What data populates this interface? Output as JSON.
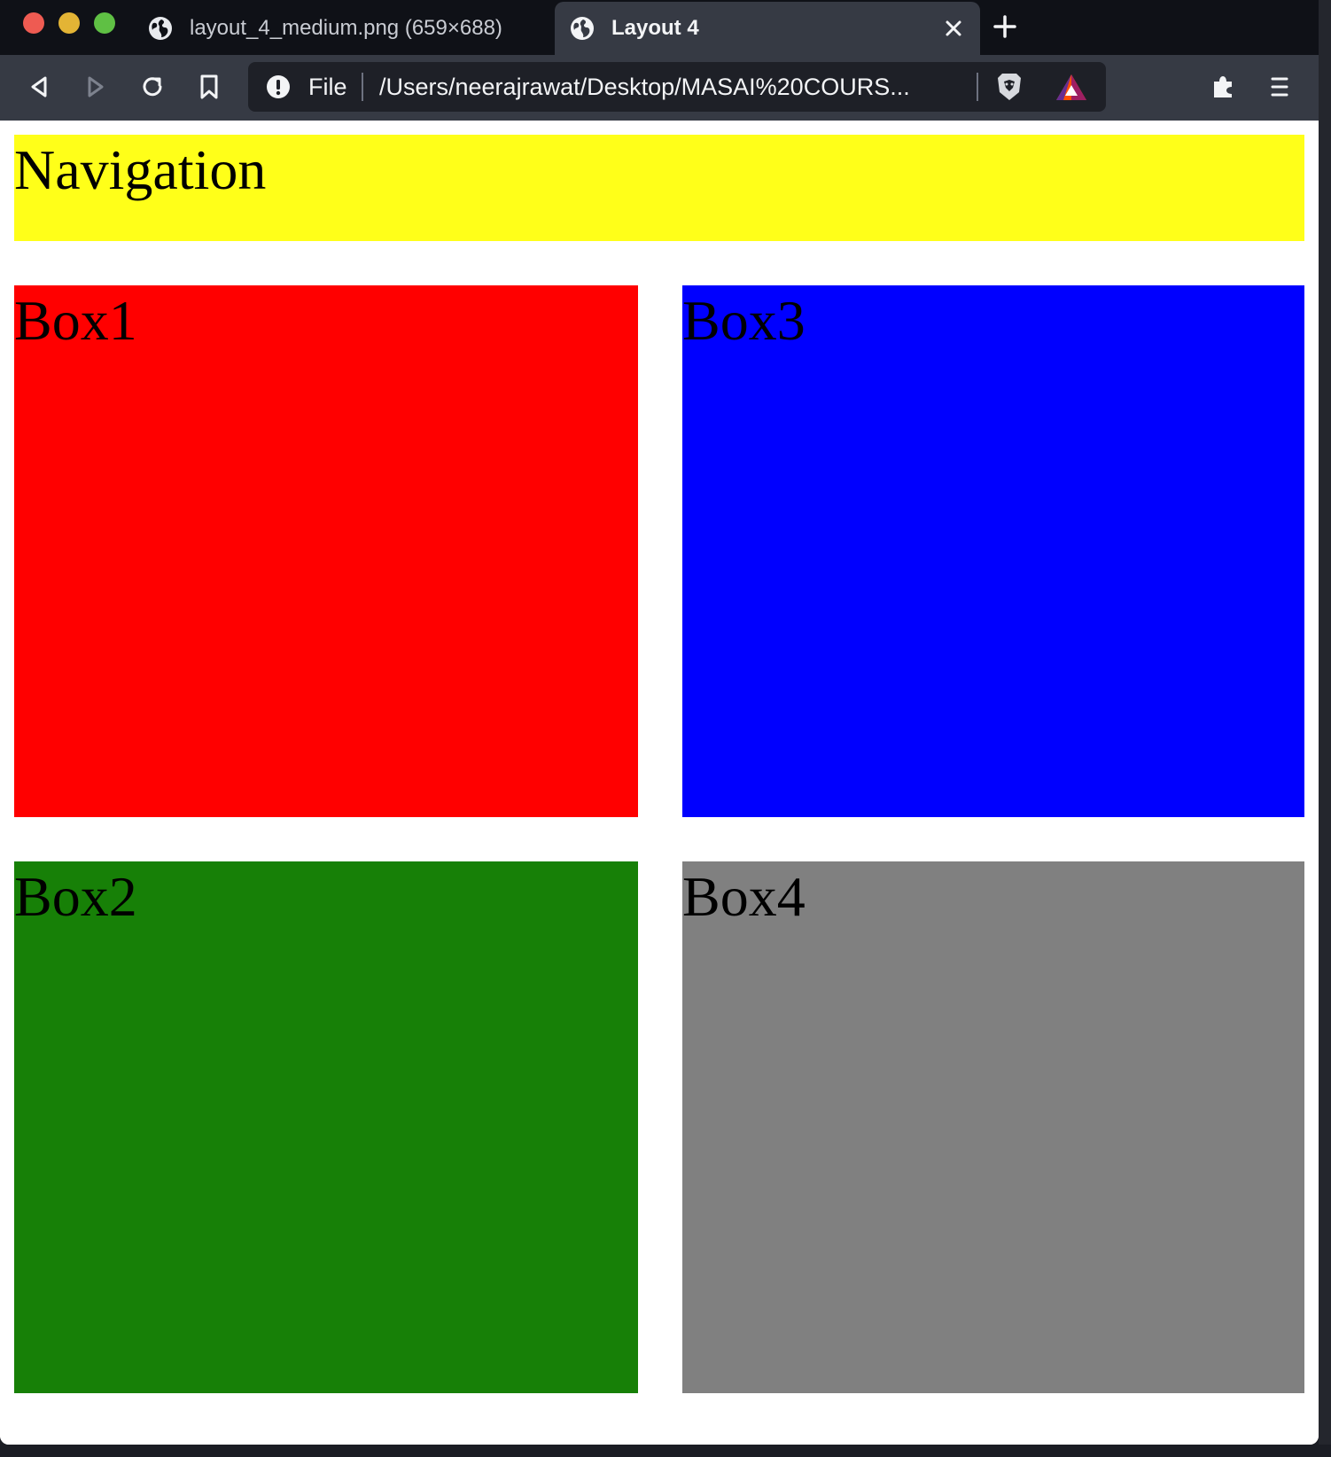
{
  "browser": {
    "tabs": [
      {
        "label": "layout_4_medium.png (659×688)",
        "active": false
      },
      {
        "label": "Layout 4",
        "active": true
      }
    ],
    "address_bar": {
      "scheme_label": "File",
      "url": "/Users/neerajrawat/Desktop/MASAI%20COURS..."
    },
    "icons": {
      "back": "back-arrow-icon",
      "forward": "forward-arrow-icon",
      "reload": "reload-icon",
      "bookmark": "bookmark-icon",
      "info": "info-icon",
      "brave": "brave-shield-icon",
      "rewards": "brave-rewards-icon",
      "extensions": "puzzle-icon",
      "menu": "hamburger-menu-icon",
      "new_tab": "plus-icon",
      "close_tab": "close-icon"
    }
  },
  "page": {
    "navigation": {
      "label": "Navigation",
      "color": "#ffff19"
    },
    "boxes": [
      {
        "label": "Box1",
        "color": "#ff0000"
      },
      {
        "label": "Box3",
        "color": "#0000ff"
      },
      {
        "label": "Box2",
        "color": "#178007"
      },
      {
        "label": "Box4",
        "color": "#808080"
      }
    ]
  }
}
